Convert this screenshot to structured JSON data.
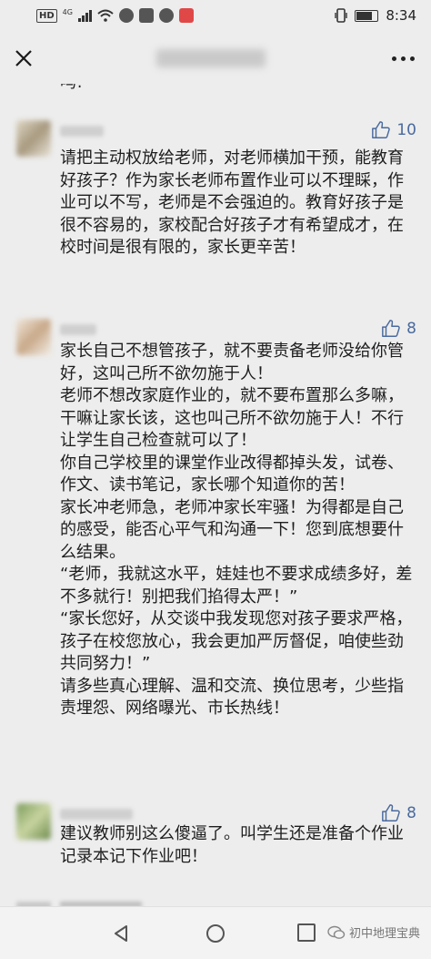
{
  "status_bar": {
    "hd": "HD",
    "network": "4G",
    "time": "8:34"
  },
  "nav": {
    "title": "",
    "close_icon": "close-icon",
    "more_icon": "more-icon"
  },
  "cutoff_text": "吗!",
  "comments": [
    {
      "likes": "10",
      "avatar_color": "#c8bfa9",
      "text": "请把主动权放给老师，对老师横加干预，能教育好孩子？作为家长老师布置作业可以不理睬，作业可以不写，老师是不会强迫的。教育好孩子是很不容易的，家校配合好孩子才有希望成才，在校时间是很有限的，家长更辛苦！"
    },
    {
      "likes": "8",
      "avatar_color": "#d9c9b6",
      "text": "家长自己不想管孩子，就不要责备老师没给你管好，这叫己所不欲勿施于人！\n老师不想改家庭作业的，就不要布置那么多嘛，干嘛让家长该，这也叫己所不欲勿施于人！不行让学生自己检查就可以了！\n你自己学校里的课堂作业改得都掉头发，试卷、作文、读书笔记，家长哪个知道你的苦！\n家长冲老师急，老师冲家长牢骚！为得都是自己的感受，能否心平气和沟通一下！您到底想要什么结果。\n“老师，我就这水平，娃娃也不要求成绩多好，差不多就行！别把我们掐得太严！”\n“家长您好，从交谈中我发现您对孩子要求严格，孩子在校您放心，我会更加严厉督促，咱使些劲共同努力！”\n请多些真心理解、温和交流、换位思考，少些指责埋怨、网络曝光、市长热线！"
    },
    {
      "likes": "8",
      "avatar_color": "#9bb07a",
      "text": "建议教师别这么傻逼了。叫学生还是准备个作业记录本记下作业吧！"
    }
  ],
  "bottom_nav": {
    "back_icon": "back-icon",
    "home_icon": "home-icon",
    "recent_icon": "recent-apps-icon",
    "watermark": "初中地理宝典"
  },
  "colors": {
    "background": "#ededed",
    "like_blue": "#4a6a9e"
  }
}
